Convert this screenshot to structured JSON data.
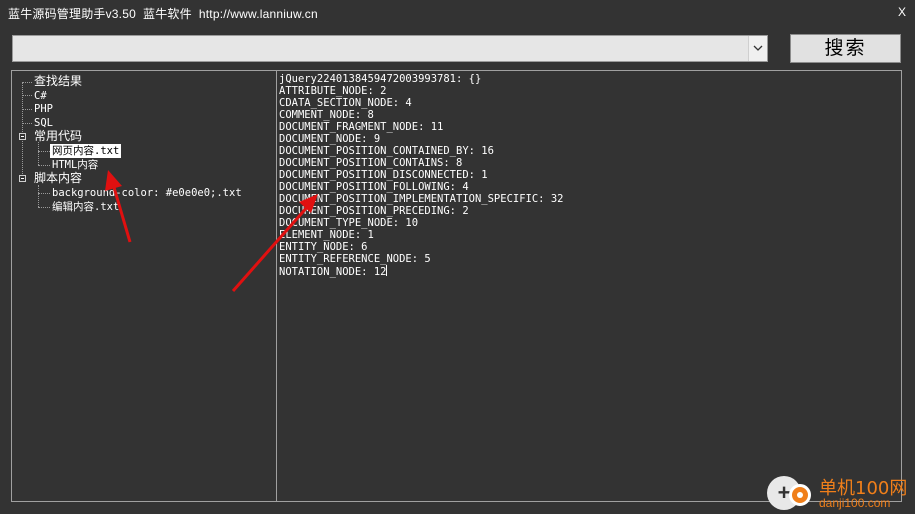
{
  "window": {
    "title": "蓝牛源码管理助手v3.50  蓝牛软件  http://www.lanniuw.cn",
    "close_label": "X"
  },
  "search": {
    "value": "",
    "placeholder": "",
    "button_label": "搜索"
  },
  "tree": {
    "items": [
      {
        "label": "查找结果"
      },
      {
        "label": "C#"
      },
      {
        "label": "PHP"
      },
      {
        "label": "SQL"
      },
      {
        "label": "常用代码",
        "expanded": true,
        "children": [
          {
            "label": "网页内容.txt",
            "selected": true
          },
          {
            "label": "HTML内容"
          }
        ]
      },
      {
        "label": "脚本内容",
        "expanded": true,
        "children": [
          {
            "label": "background-color: #e0e0e0;.txt"
          },
          {
            "label": "编辑内容.txt"
          }
        ]
      }
    ]
  },
  "content": {
    "lines": [
      "jQuery22401384594720039937​81: {}",
      "ATTRIBUTE_NODE: 2",
      "CDATA_SECTION_NODE: 4",
      "COMMENT_NODE: 8",
      "DOCUMENT_FRAGMENT_NODE: 11",
      "DOCUMENT_NODE: 9",
      "DOCUMENT_POSITION_CONTAINED_BY: 16",
      "DOCUMENT_POSITION_CONTAINS: 8",
      "DOCUMENT_POSITION_DISCONNECTED: 1",
      "DOCUMENT_POSITION_FOLLOWING: 4",
      "DOCUMENT_POSITION_IMPLEMENTATION_SPECIFIC: 32",
      "DOCUMENT_POSITION_PRECEDING: 2",
      "DOCUMENT_TYPE_NODE: 10",
      "ELEMENT_NODE: 1",
      "ENTITY_NODE: 6",
      "ENTITY_REFERENCE_NODE: 5",
      "NOTATION_NODE: 12"
    ]
  },
  "colors": {
    "background": "#333333",
    "annotation_arrow": "#e01010",
    "watermark": "#f07f1a"
  },
  "watermark": {
    "title": "单机100网",
    "subtitle": "danji100.com"
  }
}
